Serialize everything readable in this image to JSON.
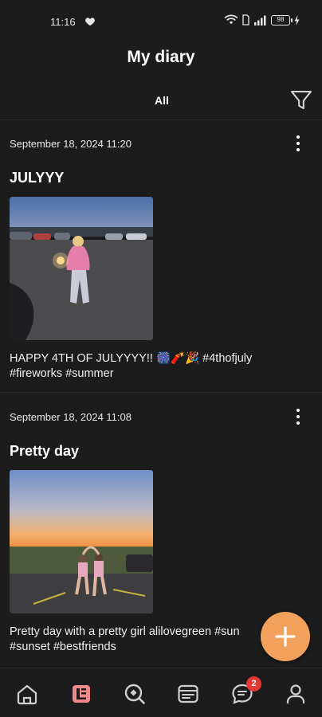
{
  "status_bar": {
    "time": "11:16",
    "battery": "98",
    "icons": [
      "heart-icon",
      "wifi-icon",
      "sim-icon",
      "signal-icon",
      "battery-icon",
      "charging-icon"
    ]
  },
  "header": {
    "title": "My diary",
    "filter_label": "All"
  },
  "entries": [
    {
      "date": "September 18, 2024 11:20",
      "title": "JULYYY",
      "text_line1": "HAPPY 4TH OF JULYYYY!! 🎆🧨🎉 #4thofjuly",
      "text_line2": "#fireworks #summer"
    },
    {
      "date": "September 18, 2024 11:08",
      "title": "Pretty day",
      "text_line1": "Pretty day with a pretty girl alilovegreen #sun",
      "text_line2": "#sunset #bestfriends"
    }
  ],
  "bottom_nav": {
    "items": [
      "home-icon",
      "diary-icon",
      "explore-icon",
      "feed-icon",
      "chat-icon",
      "profile-icon"
    ],
    "active": "diary-icon",
    "chat_badge": "2"
  },
  "colors": {
    "background": "#1c1c1c",
    "accent": "#f2a15d",
    "active_nav": "#f08a8a",
    "badge": "#e53935"
  }
}
